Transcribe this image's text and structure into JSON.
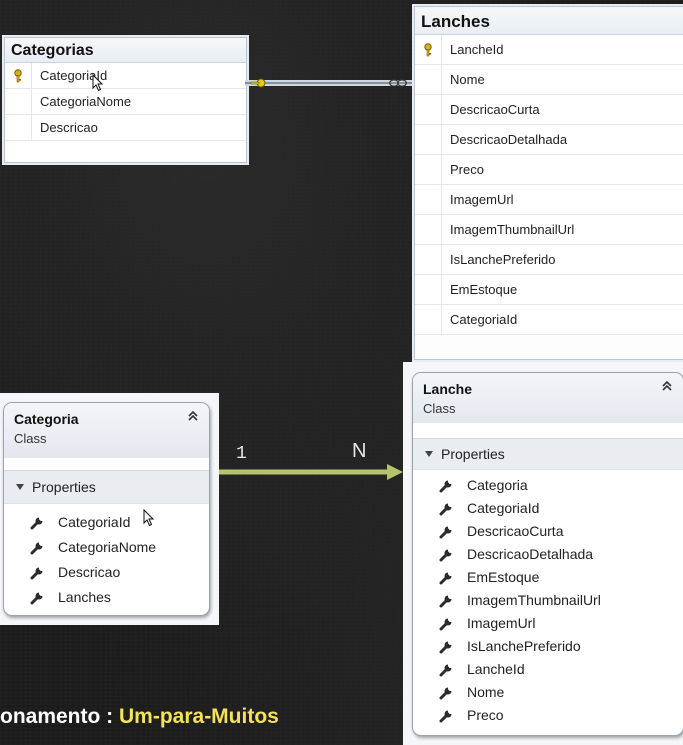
{
  "db_tables": {
    "categorias": {
      "title": "Categorias",
      "columns": [
        "CategoriaId",
        "CategoriaNome",
        "Descricao"
      ]
    },
    "lanches": {
      "title": "Lanches",
      "columns": [
        "LancheId",
        "Nome",
        "DescricaoCurta",
        "DescricaoDetalhada",
        "Preco",
        "ImagemUrl",
        "ImagemThumbnailUrl",
        "IsLanchePreferido",
        "EmEstoque",
        "CategoriaId"
      ]
    }
  },
  "classes": {
    "categoria": {
      "name": "Categoria",
      "kind": "Class",
      "section": "Properties",
      "properties": [
        "CategoriaId",
        "CategoriaNome",
        "Descricao",
        "Lanches"
      ]
    },
    "lanche": {
      "name": "Lanche",
      "kind": "Class",
      "section": "Properties",
      "properties": [
        "Categoria",
        "CategoriaId",
        "DescricaoCurta",
        "DescricaoDetalhada",
        "EmEstoque",
        "ImagemThumbnailUrl",
        "ImagemUrl",
        "IsLanchePreferido",
        "LancheId",
        "Nome",
        "Preco"
      ]
    }
  },
  "association": {
    "one": "1",
    "many": "N"
  },
  "caption": {
    "prefix": "onamento : ",
    "highlight": "Um-para-Muitos"
  },
  "colors": {
    "arrow": "#b5c46a",
    "highlight": "#f4e35a",
    "key": "#d8b21a"
  },
  "icons": {
    "primary_key": "key-icon",
    "property": "wrench-icon",
    "collapse": "chevron-up-icon"
  }
}
